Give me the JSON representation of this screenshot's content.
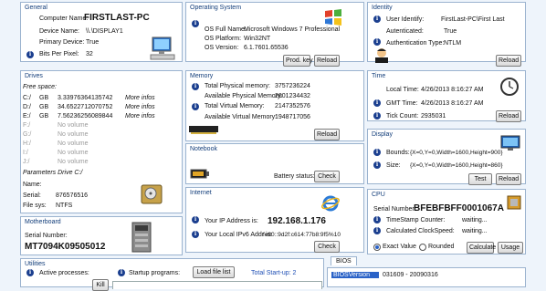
{
  "general": {
    "title": "General",
    "computer_name_label": "Computer Name:",
    "computer_name": "FIRSTLAST-PC",
    "device_name_label": "Device Name:",
    "device_name": "\\\\.\\DISPLAY1",
    "primary_device_label": "Primary Device:",
    "primary_device": "True",
    "bits_per_pixel_label": "Bits Per Pixel:",
    "bits_per_pixel": "32"
  },
  "os": {
    "title": "Operating System",
    "full_name_label": "OS Full Name:",
    "full_name": "Microsoft Windows 7 Professional",
    "platform_label": "OS Platform:",
    "platform": "Win32NT",
    "version_label": "OS Version:",
    "version": "6.1.7601.65536",
    "prod_key_button": "Prod. key",
    "reload_button": "Reload"
  },
  "identity": {
    "title": "Identity",
    "user_label": "User Identify:",
    "user": "FirstLast-PC\\First Last",
    "authenticated_label": "Autenticated:",
    "authenticated": "True",
    "auth_type_label": "Authentication Type:",
    "auth_type": "NTLM",
    "reload_button": "Reload"
  },
  "drives": {
    "title": "Drives",
    "free_space_label": "Free space:",
    "rows": [
      {
        "letter": "C:/",
        "unit": "GB",
        "value": "3.33976364135742",
        "more": "More infos"
      },
      {
        "letter": "D:/",
        "unit": "GB",
        "value": "34.6522712070752",
        "more": "More infos"
      },
      {
        "letter": "E:/",
        "unit": "GB",
        "value": "7.56236256089844",
        "more": "More infos"
      },
      {
        "letter": "F:/",
        "unit": "",
        "value": "No volume",
        "more": ""
      },
      {
        "letter": "G:/",
        "unit": "",
        "value": "No volume",
        "more": ""
      },
      {
        "letter": "H:/",
        "unit": "",
        "value": "No volume",
        "more": ""
      },
      {
        "letter": "I:/",
        "unit": "",
        "value": "No volume",
        "more": ""
      },
      {
        "letter": "J:/",
        "unit": "",
        "value": "No volume",
        "more": ""
      }
    ],
    "params_label": "Parameters Drive C:/",
    "name_label": "Name:",
    "name": "",
    "serial_label": "Serial:",
    "serial": "876576516",
    "filesys_label": "File sys:",
    "filesys": "NTFS"
  },
  "motherboard": {
    "title": "Motherboard",
    "serial_label": "Serial Number:",
    "serial": "MT7094K09505012"
  },
  "memory": {
    "title": "Memory",
    "total_phys_label": "Total Physical memory:",
    "total_phys": "3757236224",
    "avail_phys_label": "Available Physical Memory:",
    "avail_phys": "2601234432",
    "total_virt_label": "Total Virtual Memory:",
    "total_virt": "2147352576",
    "avail_virt_label": "Available Virtual Memory:",
    "avail_virt": "1948717056",
    "reload_button": "Reload"
  },
  "notebook": {
    "title": "Notebook",
    "battery_label": "Battery status:",
    "check_button": "Check"
  },
  "internet": {
    "title": "Internet",
    "ip_label": "Your IP Address is:",
    "ip": "192.168.1.176",
    "ipv6_label": "Your Local IPv6 Addr is:",
    "ipv6": "fe80::9d2f:c614:77b8:9f5%10",
    "check_button": "Check"
  },
  "time": {
    "title": "Time",
    "local_label": "Local Time:",
    "local": "4/26/2013 8:16:27 AM",
    "gmt_label": "GMT Time:",
    "gmt": "4/26/2013 8:16:27 AM",
    "tick_label": "Tick Count:",
    "tick": "2935031",
    "reload_button": "Reload"
  },
  "display": {
    "title": "Display",
    "bounds_label": "Bounds:",
    "bounds": "{X=0,Y=0,Width=1600,Height=900}",
    "size_label": "Size:",
    "size": "{X=0,Y=0,Width=1600,Height=860}",
    "test_button": "Test",
    "reload_button": "Reload"
  },
  "cpu": {
    "title": "CPU",
    "serial_label": "Serial Number:",
    "serial": "BFEBFBFF0001067A",
    "timestamp_label": "TimeStamp Counter:",
    "timestamp": "waiting...",
    "clockspeed_label": "Calculated ClockSpeed:",
    "clockspeed": "waiting...",
    "exact_label": "Exact Value",
    "rounded_label": "Rounded",
    "calculate_button": "Calculate",
    "usage_button": "Usage"
  },
  "utilities": {
    "title": "Utilities",
    "active_label": "Active processes:",
    "kill_button": "Kill",
    "startup_label": "Startup programs:",
    "loadlist_button": "Load file list",
    "total_startup_label": "Total Start-up: 2"
  },
  "bios": {
    "tab": "BIOS",
    "row_key": "BIOSVersion",
    "row_value": "031609 - 20090316"
  }
}
